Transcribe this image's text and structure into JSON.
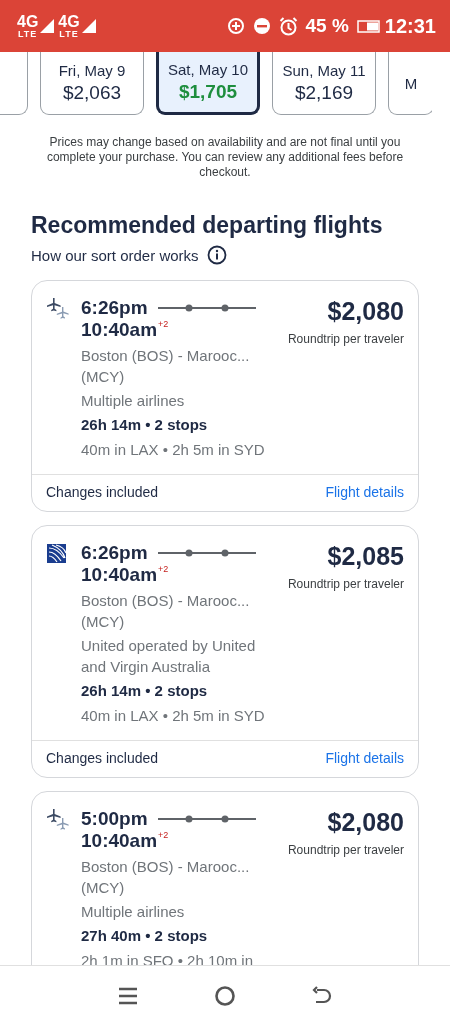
{
  "status_bar": {
    "networks": [
      {
        "label": "4G",
        "sub": "LTE"
      },
      {
        "label": "4G",
        "sub": "LTE"
      }
    ],
    "battery": "45 %",
    "time": "12:31"
  },
  "date_tabs": [
    {
      "selected": false
    },
    {
      "day": "Fri, May 9",
      "price": "$2,063",
      "selected": false
    },
    {
      "day": "Sat, May 10",
      "price": "$1,705",
      "selected": true
    },
    {
      "day": "Sun, May 11",
      "price": "$2,169",
      "selected": false
    },
    {
      "day": "M",
      "selected": false
    }
  ],
  "notice": "Prices may change based on availability and are not final until you complete your purchase. You can review any additional fees before checkout.",
  "heading": "Recommended departing flights",
  "sort_link": "How our sort order works",
  "flights": [
    {
      "kind": "multiple",
      "depart": "6:26pm",
      "arrive": "10:40am",
      "day_offset": "+2",
      "route": "Boston (BOS) - Marooc...",
      "route_code": "(MCY)",
      "airline": "Multiple airlines",
      "duration": "26h 14m • 2 stops",
      "layovers": "40m in LAX • 2h 5m in SYD",
      "price": "$2,080",
      "price_note": "Roundtrip per traveler",
      "changes": "Changes included",
      "details": "Flight details"
    },
    {
      "kind": "united",
      "depart": "6:26pm",
      "arrive": "10:40am",
      "day_offset": "+2",
      "route": "Boston (BOS) - Marooc...",
      "route_code": "(MCY)",
      "airline": "United operated by United and Virgin Australia",
      "duration": "26h 14m • 2 stops",
      "layovers": "40m in LAX • 2h 5m in SYD",
      "price": "$2,085",
      "price_note": "Roundtrip per traveler",
      "changes": "Changes included",
      "details": "Flight details"
    },
    {
      "kind": "multiple",
      "depart": "5:00pm",
      "arrive": "10:40am",
      "day_offset": "+2",
      "route": "Boston (BOS) - Marooc...",
      "route_code": "(MCY)",
      "airline": "Multiple airlines",
      "duration": "27h 40m • 2 stops",
      "layovers": "2h 1m in SFO • 2h 10m in",
      "price": "$2,080",
      "price_note": "Roundtrip per traveler"
    }
  ]
}
